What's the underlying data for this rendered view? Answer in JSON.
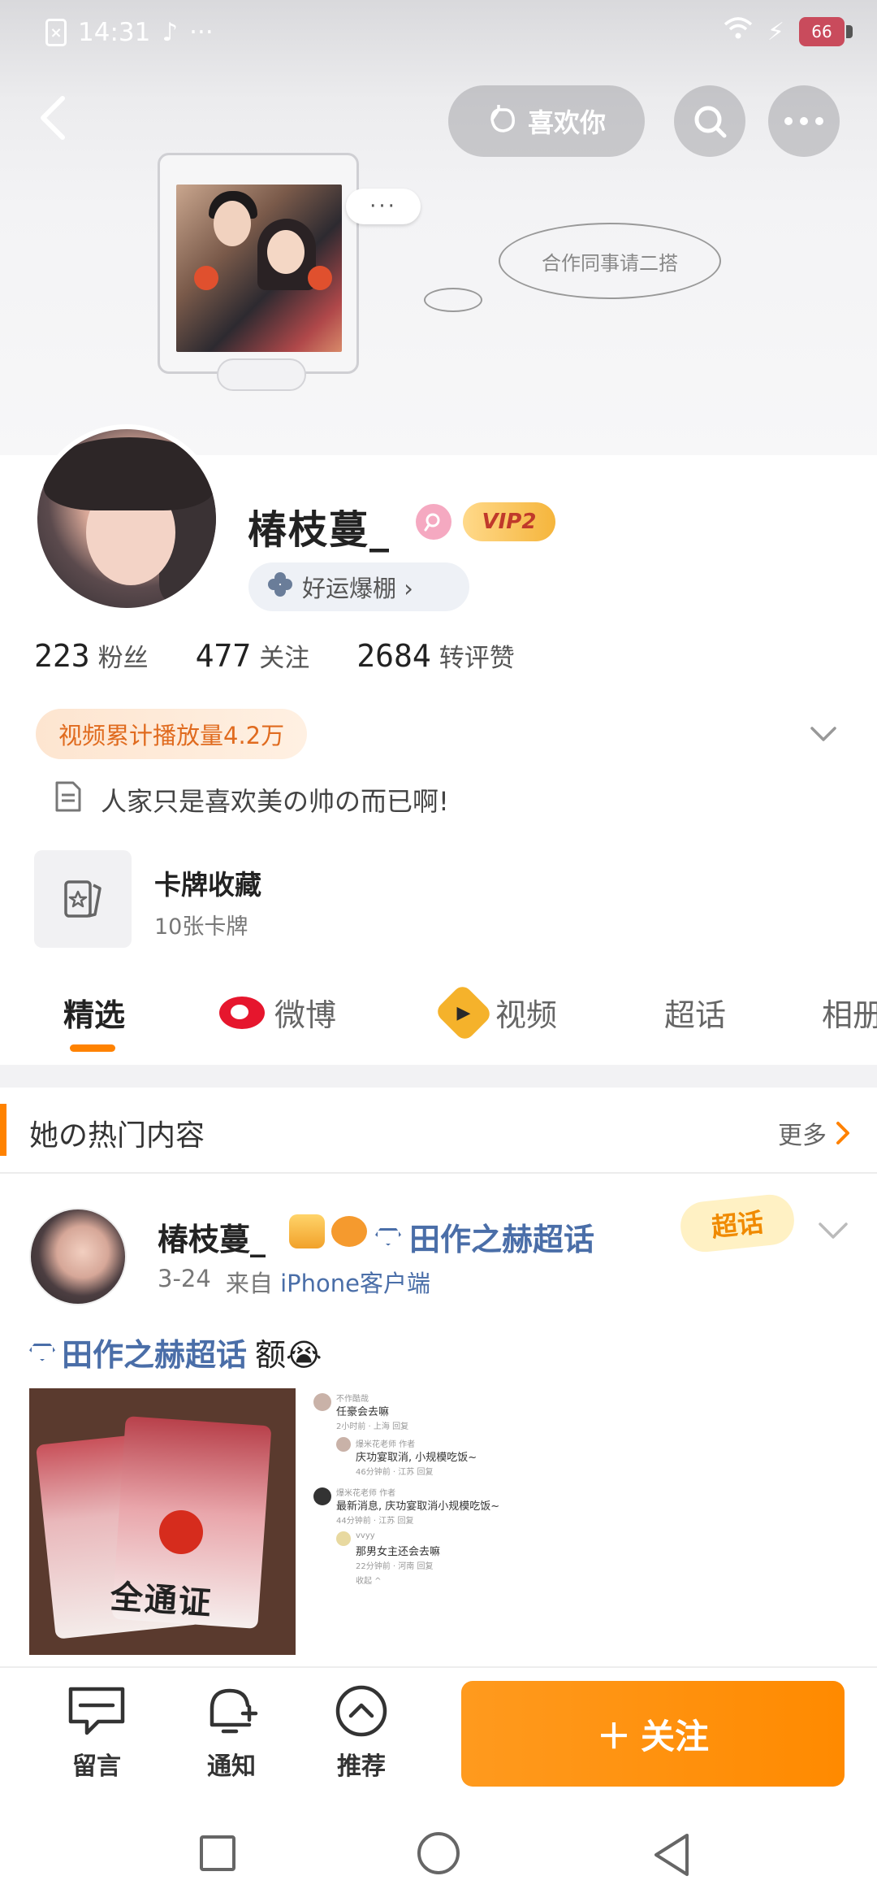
{
  "status_bar": {
    "time": "14:31",
    "dots": "···",
    "battery": "66"
  },
  "header": {
    "like_label": "喜欢你"
  },
  "cover": {
    "bubble_dots": "···",
    "bubble_text": "合作同事请二搭"
  },
  "profile": {
    "username": "椿枝蔓_",
    "vip_label": "VIP2",
    "luck_tag": "好运爆棚 ›",
    "stats": [
      {
        "num": "223",
        "label": "粉丝"
      },
      {
        "num": "477",
        "label": "关注"
      },
      {
        "num": "2684",
        "label": "转评赞"
      }
    ],
    "play_tag": "视频累计播放量4.2万",
    "bio": "人家只是喜欢美の帅の而已啊!",
    "card_title": "卡牌收藏",
    "card_sub": "10张卡牌"
  },
  "tabs": [
    {
      "label": "精选"
    },
    {
      "label": "微博"
    },
    {
      "label": "视频"
    },
    {
      "label": "超话"
    },
    {
      "label": "相册"
    }
  ],
  "hot": {
    "title": "她の热门内容",
    "more": "更多"
  },
  "post": {
    "name": "椿枝蔓_",
    "topic": "田作之赫超话",
    "super_tag": "超话",
    "date": "3-24",
    "from": "来自",
    "source": "iPhone客户端",
    "text_topic": "田作之赫超话",
    "text_body": "额😭",
    "card_text": "全通证",
    "comments": [
      {
        "name": "不作酷哉",
        "text": "任豪会去嘛",
        "meta": "2小时前 · 上海  回复"
      },
      {
        "name": "爆米花老师 作者",
        "text": "庆功宴取消, 小规模吃饭~",
        "meta": "46分钟前 · 江苏  回复"
      },
      {
        "name": "爆米花老师 作者",
        "text": "最新消息, 庆功宴取消小规模吃饭~",
        "meta": "44分钟前 · 江苏  回复"
      },
      {
        "name": "vvyy",
        "text": "那男女主还会去嘛",
        "meta": "22分钟前 · 河南  回复"
      },
      {
        "name": "",
        "text": "收起 ^",
        "meta": ""
      }
    ]
  },
  "bottom": {
    "comment": "留言",
    "notify": "通知",
    "recommend": "推荐",
    "follow": "关注"
  },
  "colors": {
    "accent": "#ff8200",
    "link": "#4a6ea8"
  }
}
